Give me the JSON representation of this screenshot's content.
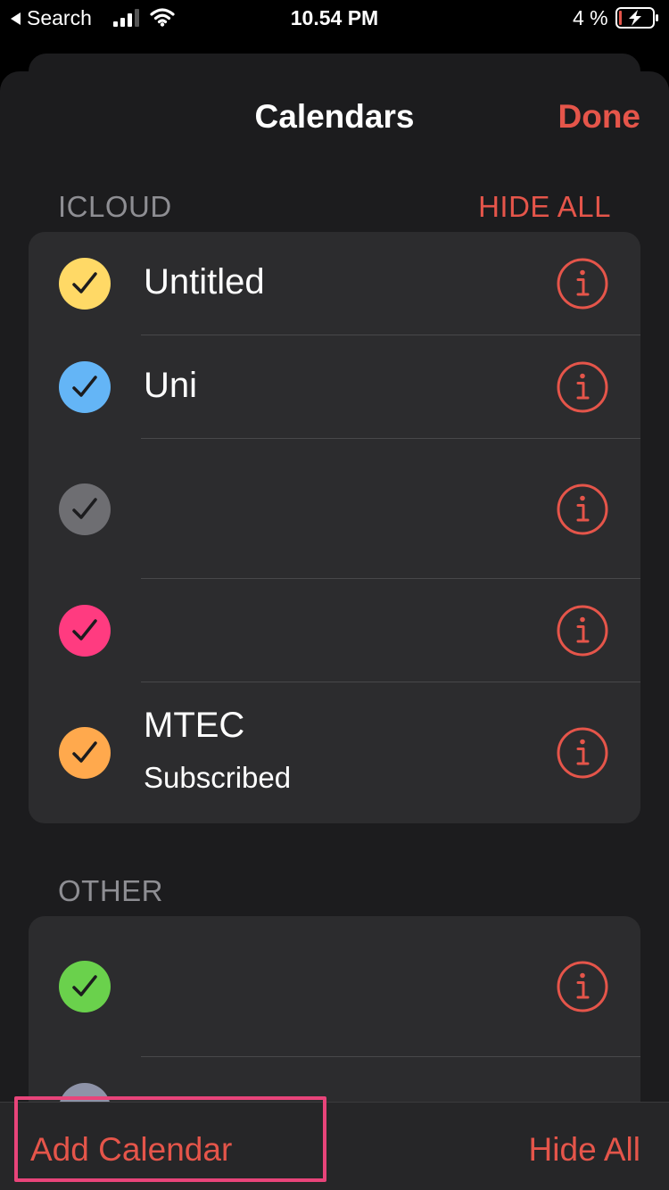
{
  "status_bar": {
    "back_label": "Search",
    "time": "10.54 PM",
    "battery": "4 %"
  },
  "sheet": {
    "title": "Calendars",
    "done_label": "Done"
  },
  "icloud_section": {
    "header": "ICLOUD",
    "action": "HIDE ALL",
    "calendars": [
      {
        "name": "Untitled",
        "subtitle": "",
        "color": "#ffd966",
        "checked": true
      },
      {
        "name": "Uni",
        "subtitle": "",
        "color": "#64b5f6",
        "checked": true
      },
      {
        "name": "",
        "subtitle": "",
        "color": "#6e6e72",
        "checked": true
      },
      {
        "name": "",
        "subtitle": "",
        "color": "#ff3b80",
        "checked": true
      },
      {
        "name": "MTEC",
        "subtitle": "Subscribed",
        "color": "#ffa94d",
        "checked": true
      }
    ]
  },
  "other_section": {
    "header": "OTHER",
    "calendars": [
      {
        "name": "",
        "subtitle": "",
        "color": "#6ad14c",
        "checked": true
      }
    ]
  },
  "toolbar": {
    "add_label": "Add Calendar",
    "hide_label": "Hide All"
  },
  "colors": {
    "accent": "#e5554a",
    "highlight": "#e8447a",
    "sheet_bg": "#1c1c1e",
    "group_bg": "#2c2c2e"
  }
}
